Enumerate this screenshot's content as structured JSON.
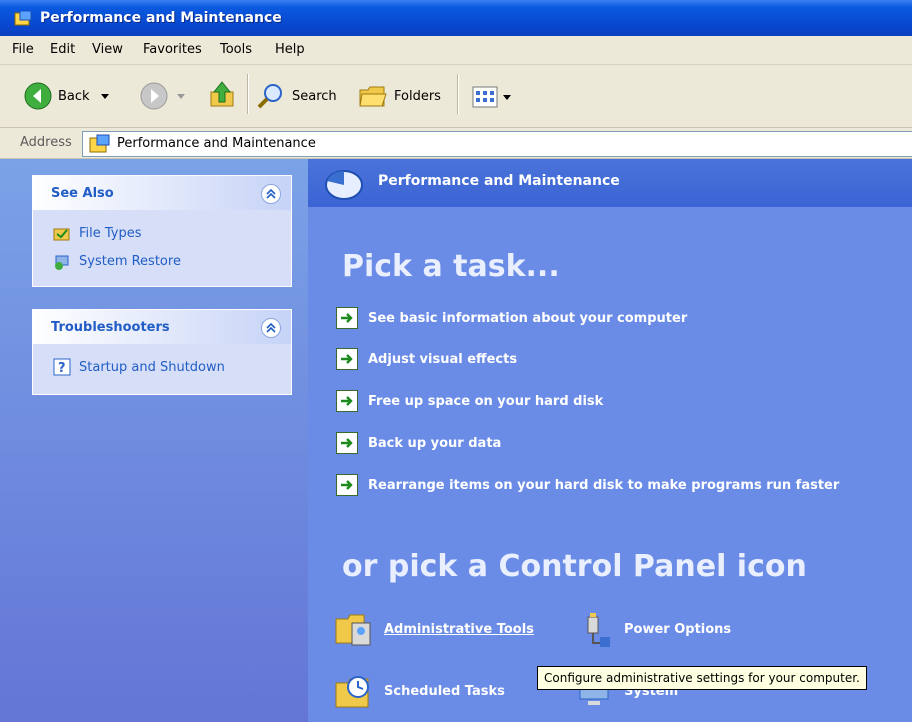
{
  "window": {
    "title": "Performance and Maintenance"
  },
  "menu": {
    "items": [
      "File",
      "Edit",
      "View",
      "Favorites",
      "Tools",
      "Help"
    ]
  },
  "toolbar": {
    "back": "Back",
    "search": "Search",
    "folders": "Folders"
  },
  "address": {
    "label": "Address",
    "value": "Performance and Maintenance"
  },
  "sidebar": {
    "see_also": {
      "title": "See Also",
      "items": [
        "File Types",
        "System Restore"
      ]
    },
    "troubleshooters": {
      "title": "Troubleshooters",
      "items": [
        "Startup and Shutdown"
      ]
    }
  },
  "main": {
    "header": "Performance and Maintenance",
    "pick_task": "Pick a task...",
    "tasks": [
      "See basic information about your computer",
      "Adjust visual effects",
      "Free up space on your hard disk",
      "Back up your data",
      "Rearrange items on your hard disk to make programs run faster"
    ],
    "or_pick": "or pick a Control Panel icon",
    "icons": [
      "Administrative Tools",
      "Power Options",
      "Scheduled Tasks",
      "System"
    ]
  },
  "tooltip": "Configure administrative settings for your computer.",
  "colors": {
    "accent": "#215DC6",
    "panel": "#6B8CE6",
    "task_text": "#FFFFFF"
  }
}
